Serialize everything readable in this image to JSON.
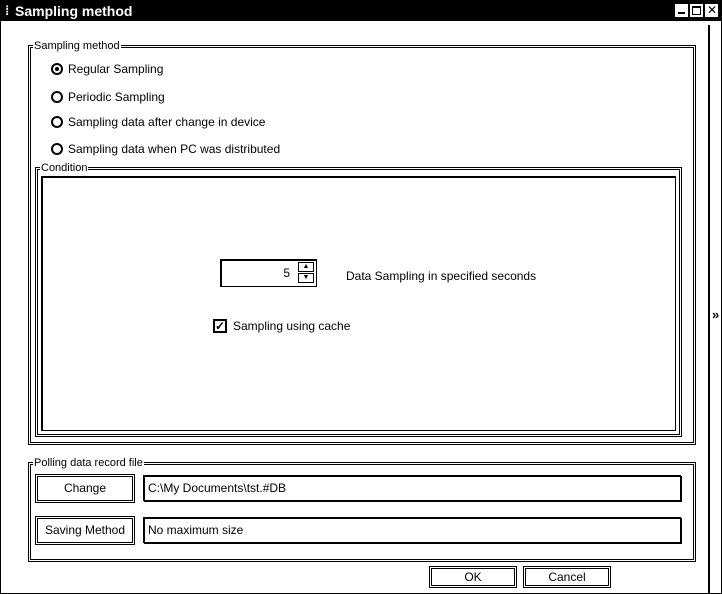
{
  "window": {
    "title": "Sampling method",
    "grip_glyph": "⁞",
    "right_edge_glyph": "»"
  },
  "sampling_group": {
    "title": "Sampling method",
    "options": [
      {
        "label": "Regular Sampling",
        "selected": true
      },
      {
        "label": "Periodic Sampling",
        "selected": false
      },
      {
        "label": "Sampling data after change in device",
        "selected": false
      },
      {
        "label": "Sampling data when PC was distributed",
        "selected": false
      }
    ]
  },
  "condition_group": {
    "title": "Condition",
    "seconds_value": "5",
    "seconds_label": "Data Sampling in specified seconds",
    "cache_checked": true,
    "cache_label": "Sampling using cache"
  },
  "polling_group": {
    "title": "Polling data record file",
    "change_button": "Change",
    "file_path": "C:\\My Documents\\tst.#DB",
    "saving_button": "Saving Method",
    "saving_value": "No maximum size"
  },
  "footer": {
    "ok_label": "OK",
    "cancel_label": "Cancel"
  }
}
